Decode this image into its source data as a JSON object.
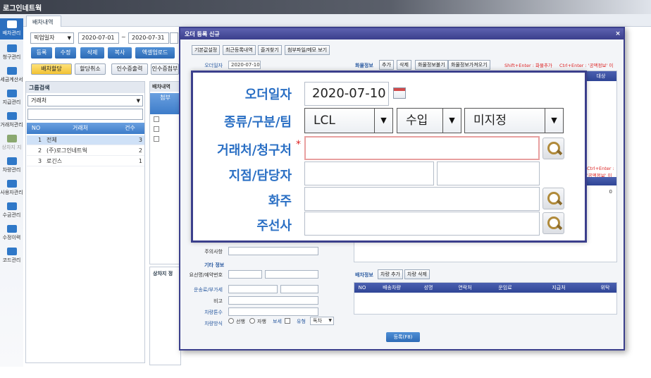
{
  "app": {
    "title": "로그인네트웍"
  },
  "sidebar": {
    "items": [
      {
        "label": "배차관리"
      },
      {
        "label": "청구관리"
      },
      {
        "label": "세금계산서"
      },
      {
        "label": "지급관리"
      },
      {
        "label": "거래처관리"
      },
      {
        "label": "상차지 지"
      },
      {
        "label": "차량관리"
      },
      {
        "label": "사용자관리"
      },
      {
        "label": "수금관리"
      },
      {
        "label": "수정이력"
      },
      {
        "label": "코드관리"
      }
    ]
  },
  "bg": {
    "tab": "배차내역",
    "date_type": "픽업일자",
    "date_from": "2020-07-01",
    "date_sep": "~",
    "date_to": "2020-07-31",
    "buttons": [
      "등록",
      "수정",
      "삭제",
      "복사",
      "엑셀업로드"
    ],
    "buttons2": [
      "배차할당",
      "할당취소",
      "인수증출력",
      "인수증첨부"
    ],
    "group_search": "그룹검색",
    "group_select": "거래처",
    "grid_headers": [
      "NO",
      "거래처",
      "건수"
    ],
    "grid_rows": [
      {
        "no": "1",
        "name": "전체",
        "count": "3"
      },
      {
        "no": "2",
        "name": "(주)로그인네트웍",
        "count": "2"
      },
      {
        "no": "3",
        "name": "로긴스",
        "count": "1"
      }
    ],
    "grid2_title": "배차내역",
    "grid2_head": "첨부",
    "loading_label": "상차지 정"
  },
  "modal": {
    "title": "오더 등록 신규",
    "close": "×",
    "top_buttons": [
      "기본값설정",
      "최근등록내역",
      "즐겨찾기",
      "첨부파일/메모 보기"
    ],
    "order_date_label": "오더일자",
    "order_date": "2020-07-10",
    "cargo_section": "화물정보",
    "cargo_buttons": [
      "추가",
      "삭제",
      "화물정보불기",
      "화물정보가져오기"
    ],
    "hint1": "Shift+Enter : 화물추가",
    "hint2": "Ctrl+Enter : '공액정보' 이",
    "hint3": "Ctrl+Enter : '공액정보' 이",
    "note_label": "주의사항",
    "other_section": "기타 정보",
    "booking_label": "요선명/예약번호",
    "fare_label": "운송료/부가세",
    "remark_label": "비고",
    "vehicle_count_label": "차량톤수",
    "vehicle_type_label": "차량방식",
    "radio1": "선행",
    "radio2": "자행",
    "insure": "보세",
    "type_label": "유형",
    "type_value": "독차",
    "cargo_zero": "0",
    "right_col_head": "대상",
    "dispatch_section": "배차정보",
    "dispatch_buttons": [
      "차량 추가",
      "차량 삭제"
    ],
    "dispatch_headers": [
      "NO",
      "배송차량",
      "성명",
      "연락처",
      "운임료",
      "지급처",
      "위탁"
    ],
    "register_button": "등록(F8)"
  },
  "zoom": {
    "order_date_label": "오더일자",
    "order_date": "2020-07-10",
    "type_label": "종류/구분/팀",
    "type_value": "LCL",
    "division_value": "수입",
    "team_value": "미지정",
    "client_label": "거래처/청구처",
    "required_mark": "*",
    "branch_label": "지점/담당자",
    "shipper_label": "화주",
    "forwarder_label": "주선사"
  }
}
